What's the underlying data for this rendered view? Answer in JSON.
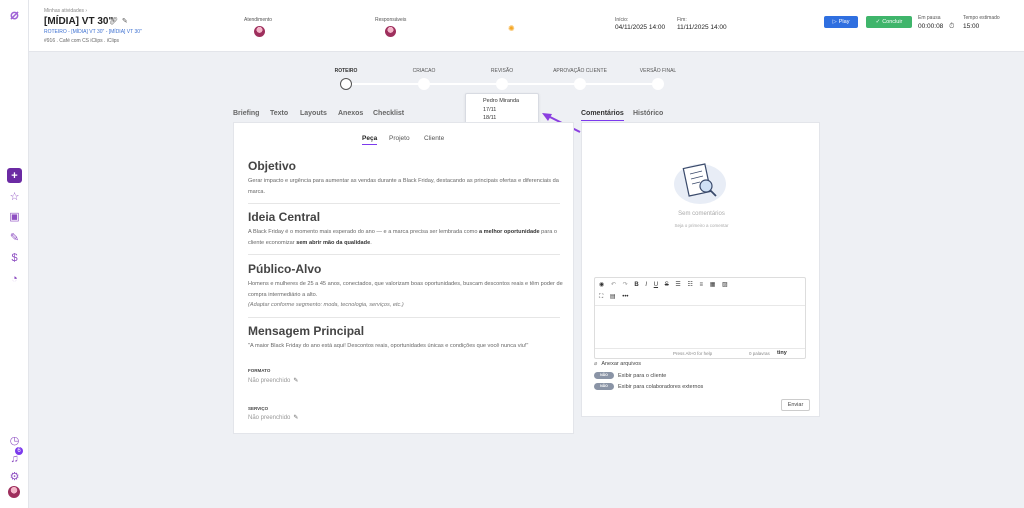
{
  "header": {
    "breadcrumb": "Minhas atividades  ›",
    "title": "[MÍDIA] VT 30\"",
    "subtitle": "ROTEIRO - [MÍDIA] VT 30\" - [MÍDIA] VT 30\"",
    "meta": "#916 . Café com CS iClips . iClips",
    "atendimento_label": "Atendimento",
    "responsaveis_label": "Responsáveis",
    "inicio_label": "Início:",
    "inicio_value": "04/11/2025 14:00",
    "fim_label": "Fim:",
    "fim_value": "11/11/2025 14:00",
    "play_label": "Play",
    "concluir_label": "Concluir",
    "em_pausa_label": "Em pausa",
    "em_pausa_value": "00:00:08",
    "tempo_estimado_label": "Tempo estimado",
    "tempo_estimado_value": "15:00"
  },
  "stepper": {
    "steps": [
      "ROTEIRO",
      "CRIACAO",
      "REVISÃO",
      "APROVAÇÃO CLIENTE",
      "VERSÃO FINAL"
    ],
    "active_index": 0
  },
  "popover": {
    "lines": [
      "Pedro Miranda",
      "17/11",
      "18/11"
    ]
  },
  "tabs": [
    "Briefing",
    "Texto",
    "Layouts",
    "Anexos",
    "Checklist"
  ],
  "subtabs": [
    "Peça",
    "Projeto",
    "Cliente"
  ],
  "content": {
    "objetivo_h": "Objetivo",
    "objetivo_p": "Gerar impacto e urgência para aumentar as vendas durante a Black Friday, destacando as principais ofertas e diferenciais da marca.",
    "ideia_h": "Ideia Central",
    "ideia_p1": "A Black Friday é o momento mais esperado do ano — e a marca precisa ser lembrada como ",
    "ideia_b1": "a melhor oportunidade",
    "ideia_p2": " para o cliente economizar ",
    "ideia_b2": "sem abrir mão da qualidade",
    "ideia_p3": ".",
    "publico_h": "Público-Alvo",
    "publico_p": "Homens e mulheres de 25 a 45 anos, conectados, que valorizam boas oportunidades, buscam descontos reais e têm poder de compra intermediário a alto.",
    "publico_note": "(Adaptar conforme segmento: moda, tecnologia, serviços, etc.)",
    "mensagem_h": "Mensagem Principal",
    "mensagem_p": "\"A maior Black Friday do ano está aqui! Descontos reais, oportunidades únicas e condições que você nunca viu!\"",
    "formato_label": "FORMATO",
    "formato_value": "Não preenchido",
    "servico_label": "SERVIÇO",
    "servico_value": "Não preenchido"
  },
  "right": {
    "tabs": [
      "Comentários",
      "Histórico"
    ],
    "empty_title": "Sem comentários",
    "empty_sub": "Seja o primeiro a comentar",
    "editor_hint": "Press Alt+0 for help",
    "editor_words": "0 palavras",
    "tiny": "tiny",
    "attach_label": "Anexar arquivos",
    "toggle_text": "NÃO",
    "show_client_label": "Exibir para o cliente",
    "show_external_label": "Exibir para colaboradores externos",
    "send_label": "Enviar"
  },
  "colors": {
    "primary": "#7c3aed",
    "play": "#2f6fe0",
    "done": "#3fb56b"
  }
}
